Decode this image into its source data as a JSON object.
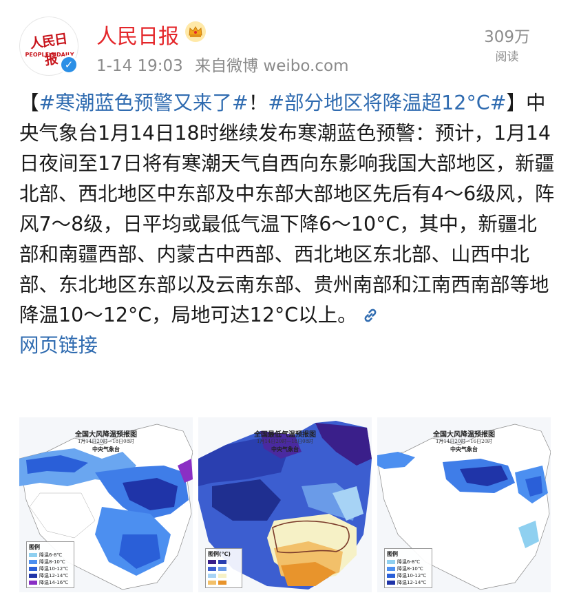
{
  "account": {
    "name": "人民日报",
    "logo_text": "人民日报",
    "logo_en": "PEOPLE'S DAILY",
    "verified_icon": "verified-check-icon",
    "vip_icon": "crown-icon",
    "time": "1-14 19:03",
    "source": "来自微博 weibo.com",
    "reads_count": "309万",
    "reads_label": "阅读"
  },
  "post": {
    "open_bracket": "【",
    "tag1": "#寒潮蓝色预警又来了#",
    "exclaim": "！",
    "tag2": "#部分地区将降温超12°C#",
    "body": "】中央气象台1月14日18时继续发布寒潮蓝色预警：预计，1月14日夜间至17日将有寒潮天气自西向东影响我国大部地区，新疆北部、西北地区中东部及中东部大部地区先后有4～6级风，阵风7～8级，日平均或最低气温下降6～10°C，其中，新疆北部和南疆西部、内蒙古中西部、西北地区东北部、山西中北部、东北地区东部以及云南东部、贵州南部和江南西南部等地降温10～12°C，局地可达12°C以上。",
    "link_label": "网页链接"
  },
  "images": [
    {
      "title": "全国大风降温预报图",
      "subtitle": "1月14日20时—18日08时",
      "agency": "中央气象台",
      "legend_title": "图例",
      "legend": [
        "降温6-8℃",
        "降温8-10℃",
        "降温10-12℃",
        "降温12-14℃",
        "降温14-16℃"
      ],
      "legend_colors": [
        "#8fd0f0",
        "#4c8ff0",
        "#2a5fd8",
        "#1f34a8",
        "#8a2fc4"
      ]
    },
    {
      "title": "全国最低气温预报图",
      "subtitle": "1月14日20时—18日08时",
      "agency": "中央气象台",
      "legend_title": "图例(℃)"
    },
    {
      "title": "全国大风降温预报图",
      "subtitle": "1月14日20时—16日20时",
      "agency": "中央气象台",
      "legend_title": "图例",
      "legend": [
        "降温6-8℃",
        "降温8-10℃",
        "降温10-12℃",
        "降温12-14℃"
      ],
      "legend_colors": [
        "#8fd0f0",
        "#4c8ff0",
        "#2a5fd8",
        "#1f34a8"
      ]
    }
  ],
  "colors": {
    "name_red": "#e4262a",
    "link_blue": "#2f6bb0",
    "verified_blue": "#2b8fe6"
  }
}
